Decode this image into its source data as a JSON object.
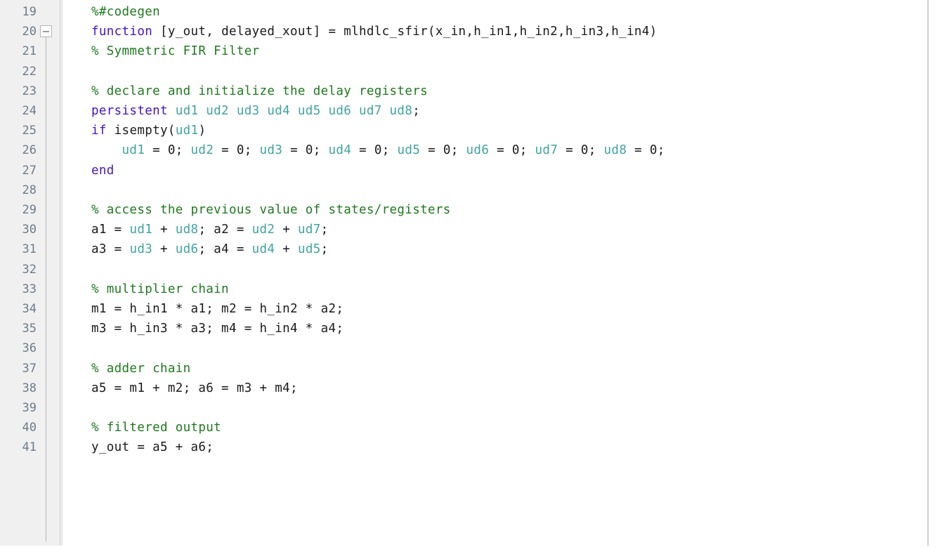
{
  "editor": {
    "language": "MATLAB",
    "first_line_number": 19,
    "last_line_number": 41,
    "colors": {
      "background": "#ffffff",
      "gutter_background": "#f0f0f0",
      "gutter_border": "#c8c8c8",
      "line_number": "#6e7b8b",
      "keyword": "#4512c8",
      "comment": "#1d7a1d",
      "persistent_variable": "#3fa3a3",
      "plain_text": "#1a1a1a"
    },
    "fold_marker": {
      "line_number": 20,
      "glyph": "minus",
      "label": "−",
      "state": "expanded"
    },
    "lines": [
      {
        "number": "19",
        "tokens": [
          {
            "t": "comment",
            "s": "%#codegen"
          }
        ]
      },
      {
        "number": "20",
        "tokens": [
          {
            "t": "kw",
            "s": "function"
          },
          {
            "t": "plain",
            "s": " [y_out, delayed_xout] = mlhdlc_sfir(x_in,h_in1,h_in2,h_in3,h_in4)"
          }
        ]
      },
      {
        "number": "21",
        "tokens": [
          {
            "t": "comment",
            "s": "% Symmetric FIR Filter"
          }
        ]
      },
      {
        "number": "22",
        "tokens": []
      },
      {
        "number": "23",
        "tokens": [
          {
            "t": "comment",
            "s": "% declare and initialize the delay registers"
          }
        ]
      },
      {
        "number": "24",
        "tokens": [
          {
            "t": "kw",
            "s": "persistent"
          },
          {
            "t": "persist",
            "s": " ud1 ud2 ud3 ud4 ud5 ud6 ud7 ud8"
          },
          {
            "t": "plain",
            "s": ";"
          }
        ]
      },
      {
        "number": "25",
        "tokens": [
          {
            "t": "kw",
            "s": "if"
          },
          {
            "t": "plain",
            "s": " isempty("
          },
          {
            "t": "persist",
            "s": "ud1"
          },
          {
            "t": "plain",
            "s": ")"
          }
        ]
      },
      {
        "number": "26",
        "tokens": [
          {
            "t": "plain",
            "s": "    "
          },
          {
            "t": "persist",
            "s": "ud1"
          },
          {
            "t": "plain",
            "s": " = 0; "
          },
          {
            "t": "persist",
            "s": "ud2"
          },
          {
            "t": "plain",
            "s": " = 0; "
          },
          {
            "t": "persist",
            "s": "ud3"
          },
          {
            "t": "plain",
            "s": " = 0; "
          },
          {
            "t": "persist",
            "s": "ud4"
          },
          {
            "t": "plain",
            "s": " = 0; "
          },
          {
            "t": "persist",
            "s": "ud5"
          },
          {
            "t": "plain",
            "s": " = 0; "
          },
          {
            "t": "persist",
            "s": "ud6"
          },
          {
            "t": "plain",
            "s": " = 0; "
          },
          {
            "t": "persist",
            "s": "ud7"
          },
          {
            "t": "plain",
            "s": " = 0; "
          },
          {
            "t": "persist",
            "s": "ud8"
          },
          {
            "t": "plain",
            "s": " = 0;"
          }
        ]
      },
      {
        "number": "27",
        "tokens": [
          {
            "t": "kw",
            "s": "end"
          }
        ]
      },
      {
        "number": "28",
        "tokens": []
      },
      {
        "number": "29",
        "tokens": [
          {
            "t": "comment",
            "s": "% access the previous value of states/registers"
          }
        ]
      },
      {
        "number": "30",
        "tokens": [
          {
            "t": "plain",
            "s": "a1 = "
          },
          {
            "t": "persist",
            "s": "ud1"
          },
          {
            "t": "plain",
            "s": " + "
          },
          {
            "t": "persist",
            "s": "ud8"
          },
          {
            "t": "plain",
            "s": "; a2 = "
          },
          {
            "t": "persist",
            "s": "ud2"
          },
          {
            "t": "plain",
            "s": " + "
          },
          {
            "t": "persist",
            "s": "ud7"
          },
          {
            "t": "plain",
            "s": ";"
          }
        ]
      },
      {
        "number": "31",
        "tokens": [
          {
            "t": "plain",
            "s": "a3 = "
          },
          {
            "t": "persist",
            "s": "ud3"
          },
          {
            "t": "plain",
            "s": " + "
          },
          {
            "t": "persist",
            "s": "ud6"
          },
          {
            "t": "plain",
            "s": "; a4 = "
          },
          {
            "t": "persist",
            "s": "ud4"
          },
          {
            "t": "plain",
            "s": " + "
          },
          {
            "t": "persist",
            "s": "ud5"
          },
          {
            "t": "plain",
            "s": ";"
          }
        ]
      },
      {
        "number": "32",
        "tokens": []
      },
      {
        "number": "33",
        "tokens": [
          {
            "t": "comment",
            "s": "% multiplier chain"
          }
        ]
      },
      {
        "number": "34",
        "tokens": [
          {
            "t": "plain",
            "s": "m1 = h_in1 * a1; m2 = h_in2 * a2;"
          }
        ]
      },
      {
        "number": "35",
        "tokens": [
          {
            "t": "plain",
            "s": "m3 = h_in3 * a3; m4 = h_in4 * a4;"
          }
        ]
      },
      {
        "number": "36",
        "tokens": []
      },
      {
        "number": "37",
        "tokens": [
          {
            "t": "comment",
            "s": "% adder chain"
          }
        ]
      },
      {
        "number": "38",
        "tokens": [
          {
            "t": "plain",
            "s": "a5 = m1 + m2; a6 = m3 + m4;"
          }
        ]
      },
      {
        "number": "39",
        "tokens": []
      },
      {
        "number": "40",
        "tokens": [
          {
            "t": "comment",
            "s": "% filtered output"
          }
        ]
      },
      {
        "number": "41",
        "tokens": [
          {
            "t": "plain",
            "s": "y_out = a5 + a6;"
          }
        ]
      }
    ]
  }
}
